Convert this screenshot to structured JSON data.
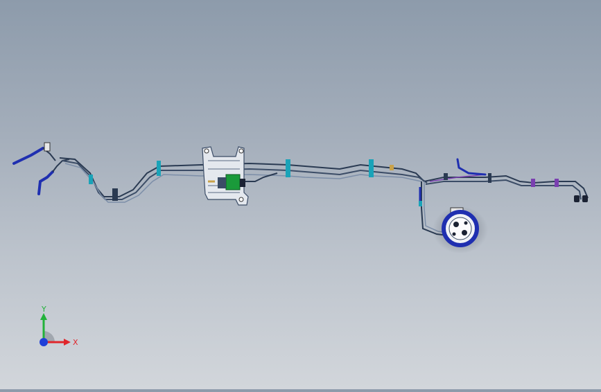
{
  "viewport": {
    "background_top": "#8d9bab",
    "background_bottom": "#d2d6db"
  },
  "model": {
    "pipe_color": "#2a3a52",
    "pipe_highlight": "#7c8ea8",
    "clip_color": "#1aa3b8",
    "hose_color": "#1f2fb0",
    "accent_purple": "#7a3fb0",
    "pump_color": "#1a9a3a"
  },
  "triad": {
    "x_label": "X",
    "y_label": "Y",
    "x_color": "#e0262b",
    "y_color": "#22b23a",
    "z_color": "#1f3fd8"
  }
}
